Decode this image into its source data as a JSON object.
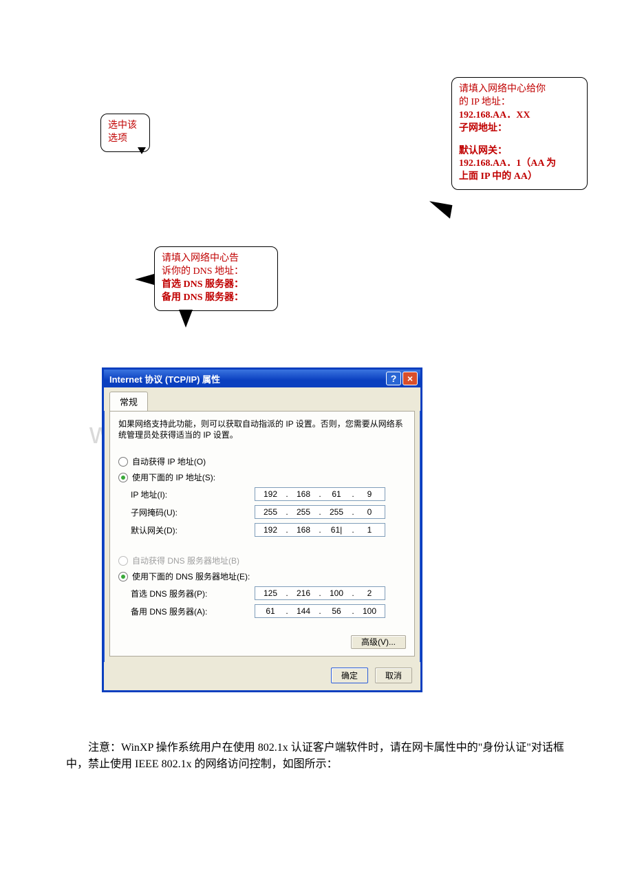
{
  "callouts": {
    "opt": {
      "l1": "选中该",
      "l2": "选项"
    },
    "ip": {
      "l1": "请填入网络中心给你",
      "l2": "的 IP 地址：",
      "l3": "192.168.AA．XX",
      "l4": "子网地址：",
      "l5": "",
      "l6": "默认网关：",
      "l7": "192.168.AA．1（AA 为",
      "l8": "上面 IP 中的 AA）"
    },
    "dns": {
      "l1": "请填入网络中心告",
      "l2": "诉你的 DNS 地址：",
      "l3": "首选 DNS 服务器：",
      "l4": "备用 DNS 服务器："
    }
  },
  "dialog": {
    "title": "Internet 协议 (TCP/IP) 属性",
    "help": "?",
    "close": "×",
    "tab": "常规",
    "desc": "如果网络支持此功能，则可以获取自动指派的 IP 设置。否则，您需要从网络系统管理员处获得适当的 IP 设置。",
    "radio_auto_ip": "自动获得 IP 地址(O)",
    "radio_use_ip": "使用下面的 IP 地址(S):",
    "label_ip": "IP 地址(I):",
    "label_mask": "子网掩码(U):",
    "label_gw": "默认网关(D):",
    "radio_auto_dns": "自动获得 DNS 服务器地址(B)",
    "radio_use_dns": "使用下面的 DNS 服务器地址(E):",
    "label_dns1": "首选 DNS 服务器(P):",
    "label_dns2": "备用 DNS 服务器(A):",
    "ip": {
      "a": "192",
      "b": "168",
      "c": "61",
      "d": "9"
    },
    "mask": {
      "a": "255",
      "b": "255",
      "c": "255",
      "d": "0"
    },
    "gw": {
      "a": "192",
      "b": "168",
      "c": "61|",
      "d": "1"
    },
    "dns1": {
      "a": "125",
      "b": "216",
      "c": "100",
      "d": "2"
    },
    "dns2": {
      "a": "61",
      "b": "144",
      "c": "56",
      "d": "100"
    },
    "btn_adv": "高级(V)...",
    "btn_ok": "确定",
    "btn_cancel": "取消"
  },
  "watermark": "www.bdocx.com",
  "note": "注意：WinXP 操作系统用户在使用 802.1x 认证客户端软件时，请在网卡属性中的\"身份认证\"对话框中，禁止使用 IEEE 802.1x 的网络访问控制，如图所示："
}
